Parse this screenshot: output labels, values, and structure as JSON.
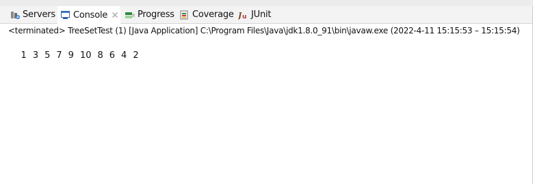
{
  "tabs": [
    {
      "label": "Servers",
      "icon": "servers-icon"
    },
    {
      "label": "Console",
      "icon": "console-icon",
      "active": true
    },
    {
      "label": "Progress",
      "icon": "progress-icon"
    },
    {
      "label": "Coverage",
      "icon": "coverage-icon"
    },
    {
      "label": "JUnit",
      "icon": "junit-icon"
    }
  ],
  "console": {
    "status": "<terminated> TreeSetTest (1) [Java Application] C:\\Program Files\\Java\\jdk1.8.0_91\\bin\\javaw.exe  (2022-4-11 15:15:53 – 15:15:54)",
    "output": [
      "1",
      "3",
      "5",
      "7",
      "9",
      "10",
      "8",
      "6",
      "4",
      "2"
    ]
  },
  "colors": {
    "tab_bar": "#f3f3f3",
    "active_tab": "#ffffff",
    "text": "#111111"
  }
}
